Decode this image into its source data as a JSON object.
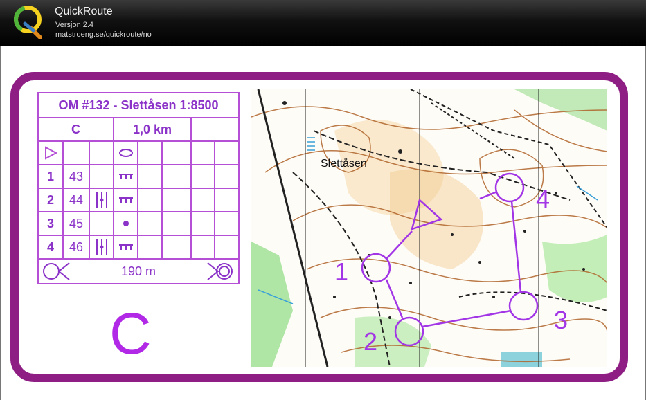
{
  "app": {
    "title": "QuickRoute",
    "version": "Versjon 2.4",
    "url": "matstroeng.se/quickroute/no"
  },
  "description": {
    "title": "OM #132 - Slettåsen 1:8500",
    "class": "C",
    "length": "1,0 km",
    "controls": [
      {
        "number": "1",
        "code": "43",
        "feature": "comb-icon",
        "detail": ""
      },
      {
        "number": "2",
        "code": "44",
        "feature": "comb-icon",
        "detail": "between-features-icon"
      },
      {
        "number": "3",
        "code": "45",
        "feature": "dot-icon",
        "detail": ""
      },
      {
        "number": "4",
        "code": "46",
        "feature": "comb-icon",
        "detail": "between-features-icon"
      }
    ],
    "finish_distance": "190 m"
  },
  "big_class": "C",
  "map": {
    "place_name": "Slettåsen",
    "control_labels": [
      "1",
      "2",
      "3",
      "4"
    ],
    "colors": {
      "course": "#a236e6",
      "frame": "#8e1e84",
      "contour": "#b0642a",
      "veg": "#8fd98a",
      "yellow": "#f5c98e"
    }
  }
}
